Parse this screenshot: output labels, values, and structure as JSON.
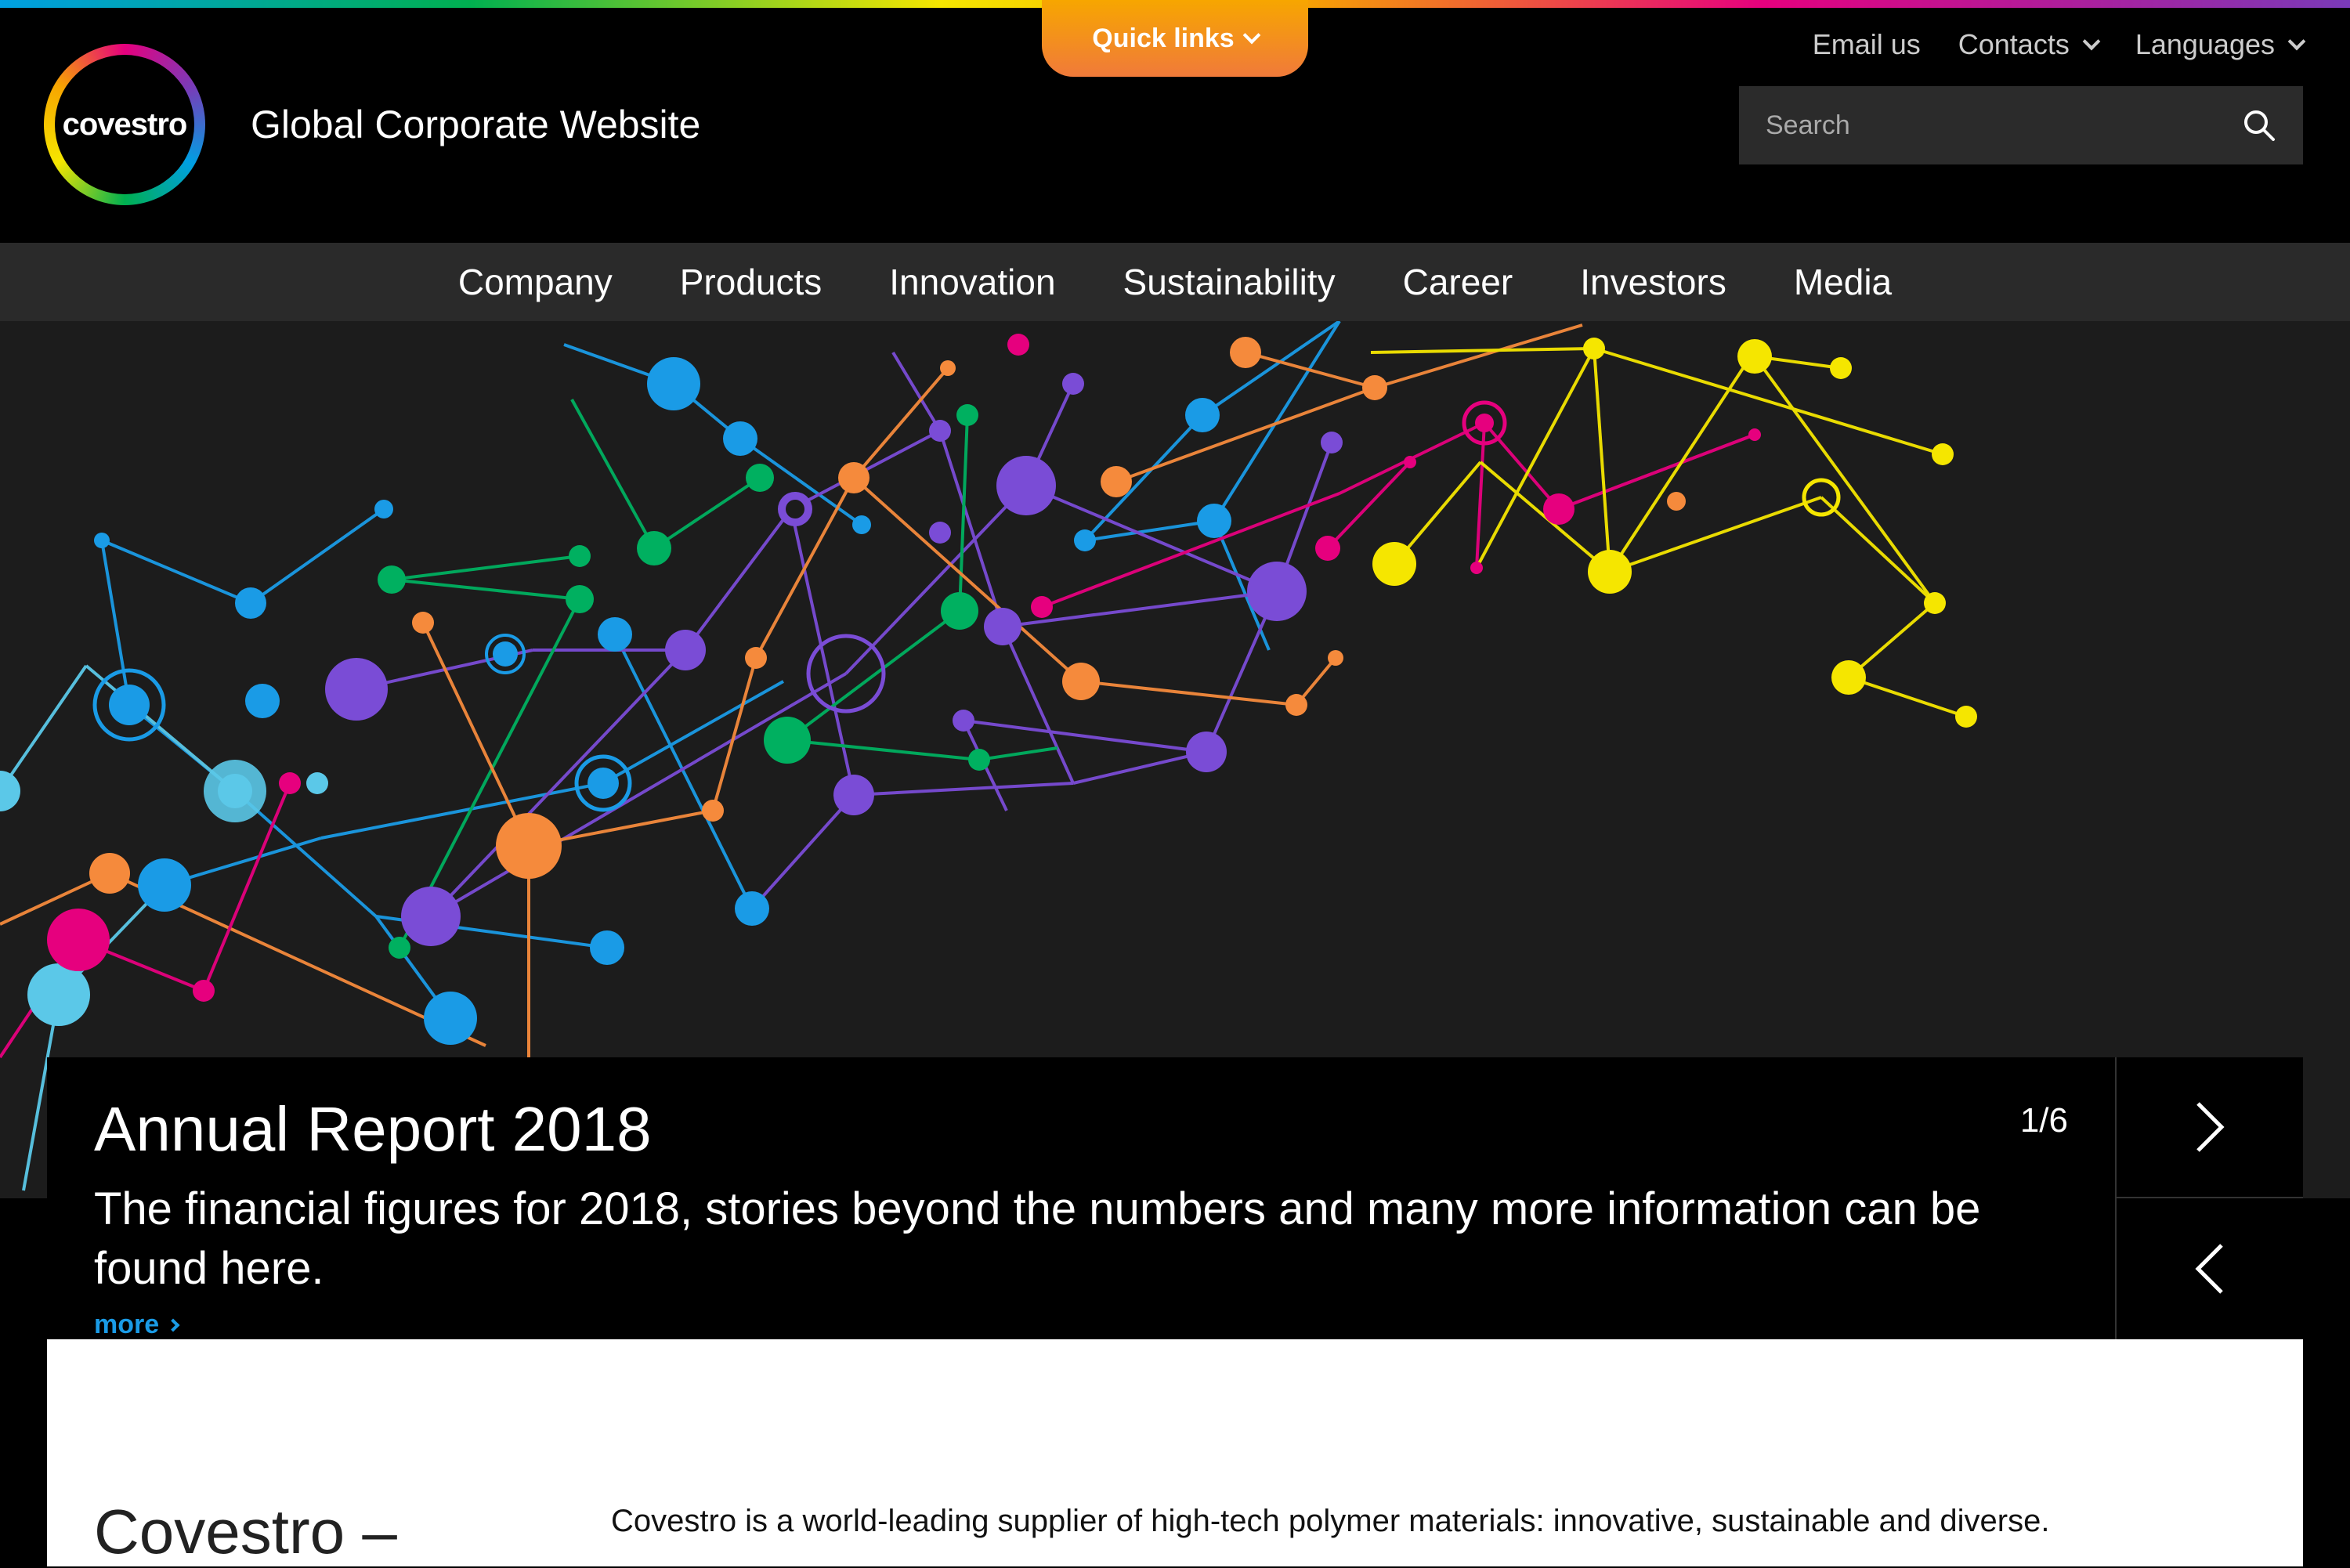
{
  "quick_links": {
    "label": "Quick links"
  },
  "header": {
    "logo_text": "covestro",
    "site_title": "Global Corporate Website",
    "util": {
      "email": "Email us",
      "contacts": "Contacts",
      "languages": "Languages"
    },
    "search": {
      "placeholder": "Search"
    }
  },
  "nav": {
    "items": [
      "Company",
      "Products",
      "Innovation",
      "Sustainability",
      "Career",
      "Investors",
      "Media"
    ]
  },
  "hero": {
    "title": "Annual Report 2018",
    "description": "The financial figures for 2018, stories beyond the numbers and many more information can be found here.",
    "more": "more",
    "counter": "1/6"
  },
  "content": {
    "heading": "Covestro –",
    "text": "Covestro is a world-leading supplier of high-tech polymer materials: innovative, sustainable and diverse."
  },
  "colors": {
    "accent_blue": "#009fe3",
    "accent_orange": "#f7a600",
    "accent_pink": "#e6007e",
    "accent_purple": "#7a3ab8",
    "accent_green": "#00b050",
    "accent_yellow": "#f5e600"
  },
  "icons": {
    "search": "search-icon",
    "chevron": "chevron-down-icon",
    "next": "chevron-right-icon",
    "prev": "chevron-left-icon"
  }
}
